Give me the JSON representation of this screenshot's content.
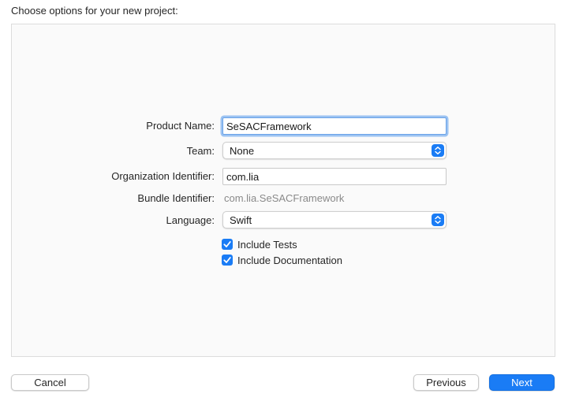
{
  "header": {
    "title": "Choose options for your new project:"
  },
  "form": {
    "product_name": {
      "label": "Product Name:",
      "value": "SeSACFramework"
    },
    "team": {
      "label": "Team:",
      "value": "None"
    },
    "organization_identifier": {
      "label": "Organization Identifier:",
      "value": "com.lia"
    },
    "bundle_identifier": {
      "label": "Bundle Identifier:",
      "value": "com.lia.SeSACFramework"
    },
    "language": {
      "label": "Language:",
      "value": "Swift"
    },
    "include_tests": {
      "label": "Include Tests",
      "checked": true
    },
    "include_documentation": {
      "label": "Include Documentation",
      "checked": true
    }
  },
  "footer": {
    "cancel_label": "Cancel",
    "previous_label": "Previous",
    "next_label": "Next"
  },
  "colors": {
    "accent": "#1a7cf5",
    "focus_ring": "#9cc3f2"
  },
  "icons": {
    "popup_stepper": "chevron-up-down-icon",
    "checkbox": "checkmark-icon"
  }
}
